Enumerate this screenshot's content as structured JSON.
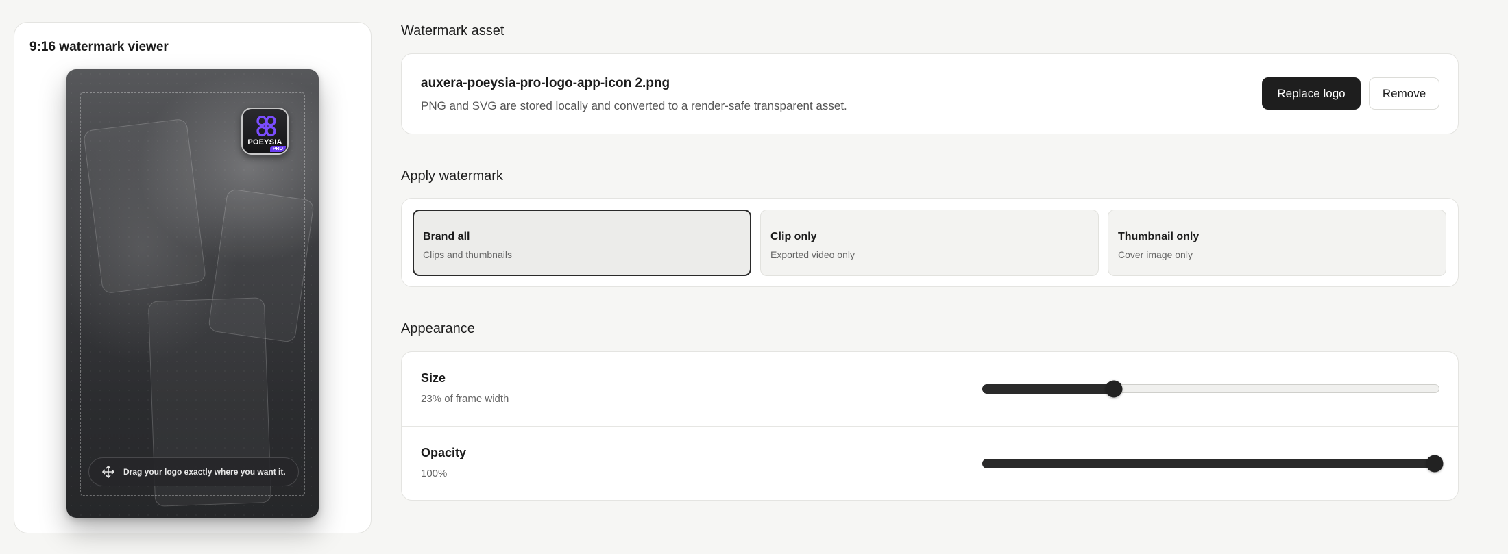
{
  "viewer": {
    "title": "9:16 watermark viewer",
    "logo_word": "POEYSIA",
    "logo_pro": "PRO",
    "drag_hint": "Drag your logo exactly where you want it."
  },
  "asset": {
    "section_title": "Watermark asset",
    "file_name": "auxera-poeysia-pro-logo-app-icon 2.png",
    "description": "PNG and SVG are stored locally and converted to a render-safe transparent asset.",
    "replace_label": "Replace logo",
    "remove_label": "Remove"
  },
  "apply": {
    "section_title": "Apply watermark",
    "selected_index": 0,
    "options": [
      {
        "title": "Brand all",
        "subtitle": "Clips and thumbnails"
      },
      {
        "title": "Clip only",
        "subtitle": "Exported video only"
      },
      {
        "title": "Thumbnail only",
        "subtitle": "Cover image only"
      }
    ]
  },
  "appearance": {
    "section_title": "Appearance",
    "size": {
      "label": "Size",
      "value_text": "23% of frame width",
      "level": 0.29
    },
    "opacity": {
      "label": "Opacity",
      "value_text": "100%",
      "level": 1.0
    }
  },
  "colors": {
    "background": "#f6f6f4",
    "primary_button": "#1e1e1e",
    "logo_accent": "#6a3df0"
  },
  "icons": {
    "logo_mark": "butterfly-logo-icon",
    "drag_hint": "move-arrows-icon"
  }
}
